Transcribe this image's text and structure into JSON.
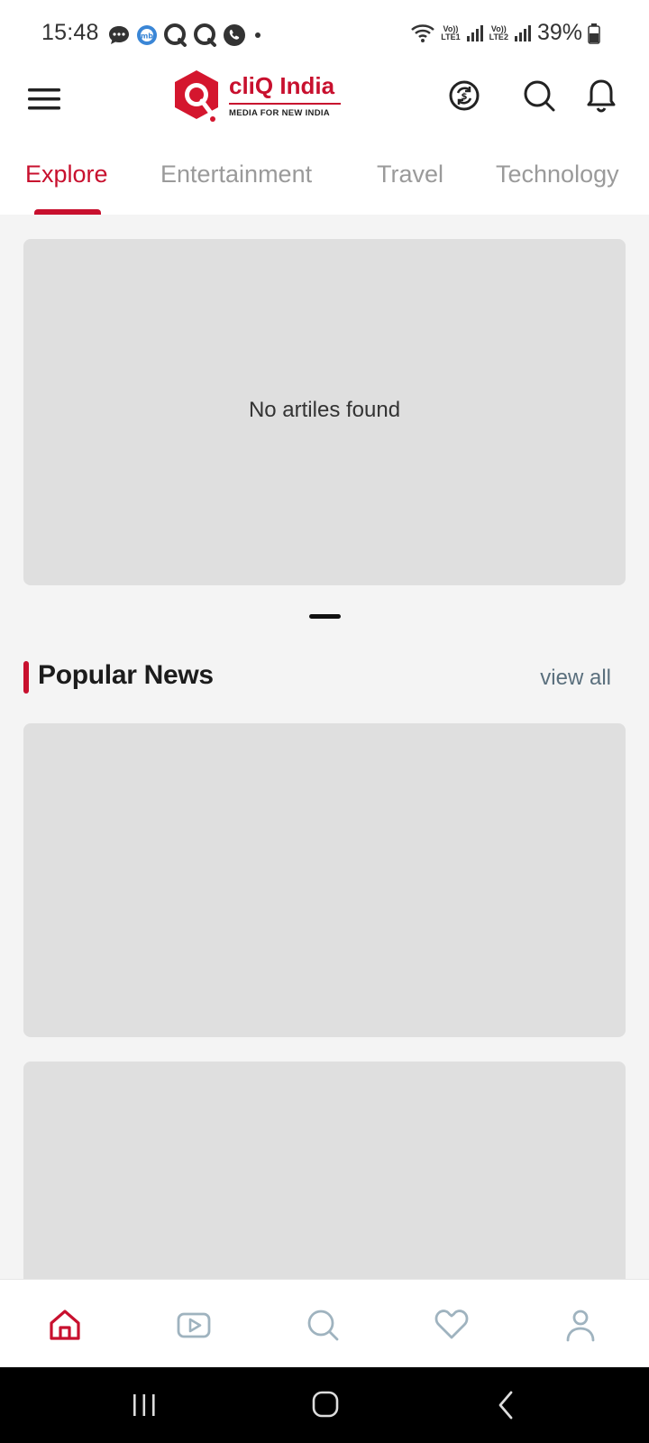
{
  "status_bar": {
    "time": "15:48",
    "left_icons": [
      "chat-bubble-icon",
      "messenger-app-icon",
      "q-app-icon",
      "q-app-icon",
      "phone-icon",
      "dot-icon"
    ],
    "net1_top": "Vo))",
    "net1_bottom": "LTE1",
    "net2_top": "Vo))",
    "net2_bottom": "LTE2",
    "battery": "39%"
  },
  "header": {
    "logo_title": "cliQ India",
    "logo_subtitle": "MEDIA FOR NEW INDIA",
    "icons": [
      "menu-icon",
      "refresh-coin-icon",
      "search-icon",
      "bell-icon"
    ],
    "brand_color": "#c8102e"
  },
  "tabs": [
    {
      "label": "Explore",
      "active": true
    },
    {
      "label": "Entertainment",
      "active": false
    },
    {
      "label": "Travel",
      "active": false
    },
    {
      "label": "Technology",
      "active": false
    }
  ],
  "carousel": {
    "empty_message": "No artiles found"
  },
  "popular_news": {
    "title": "Popular News",
    "view_all": "view all"
  },
  "bottom_nav": {
    "items": [
      "home-icon",
      "video-icon",
      "search-icon",
      "heart-icon",
      "profile-icon"
    ],
    "active": "home-icon"
  },
  "system_nav": [
    "recents-icon",
    "home-button-icon",
    "back-icon"
  ]
}
